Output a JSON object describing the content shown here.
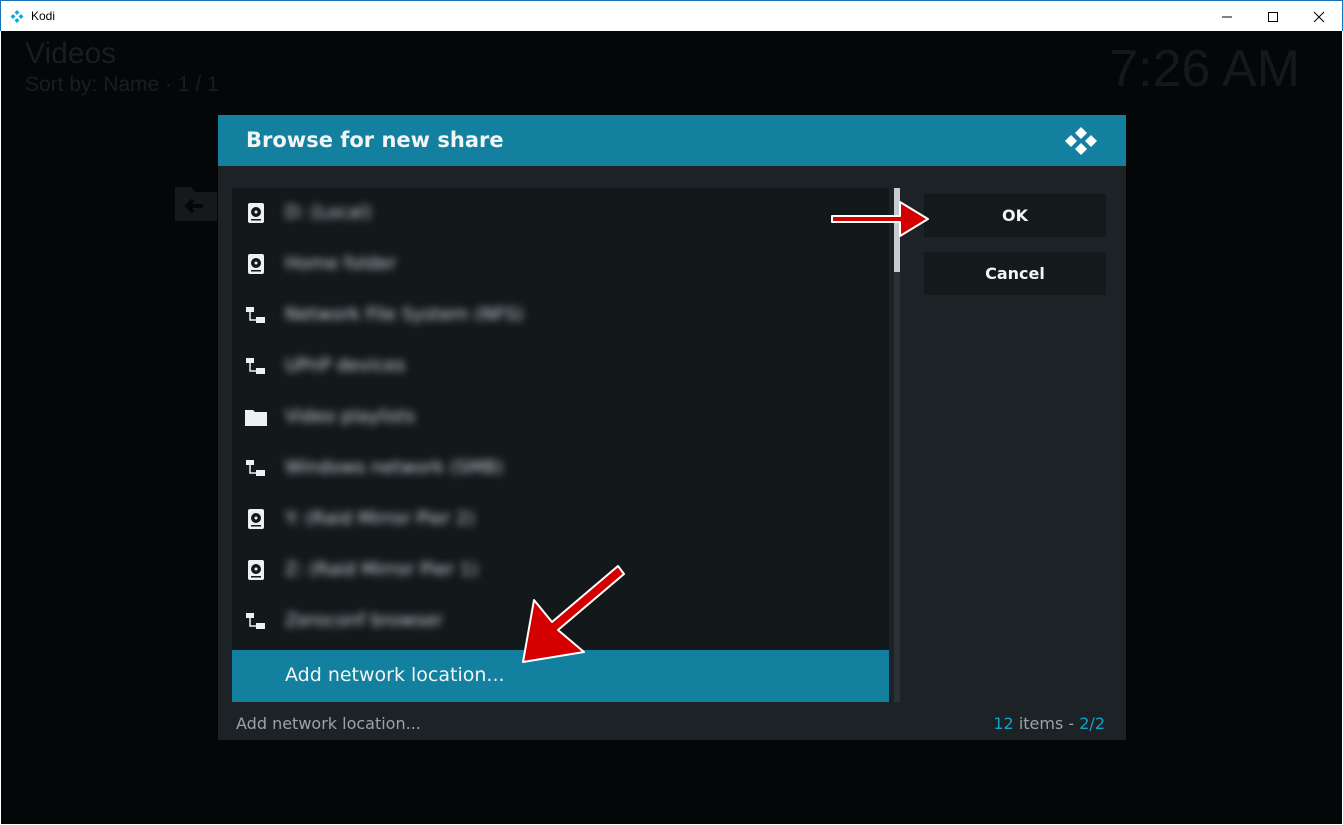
{
  "window": {
    "title": "Kodi"
  },
  "background": {
    "section_title": "Videos",
    "sort_info": "Sort by: Name  ·  1 / 1",
    "clock": "7:26 AM"
  },
  "dialog": {
    "title": "Browse for new share",
    "items": [
      {
        "label": "D: (Local)",
        "icon": "hard-drive-icon"
      },
      {
        "label": "Home folder",
        "icon": "hard-drive-icon"
      },
      {
        "label": "Network File System (NFS)",
        "icon": "network-icon"
      },
      {
        "label": "UPnP devices",
        "icon": "network-icon"
      },
      {
        "label": "Video playlists",
        "icon": "folder-icon"
      },
      {
        "label": "Windows network (SMB)",
        "icon": "network-icon"
      },
      {
        "label": "Y: (Raid Mirror Pier 2)",
        "icon": "hard-drive-icon"
      },
      {
        "label": "Z: (Raid Mirror Pier 1)",
        "icon": "hard-drive-icon"
      },
      {
        "label": "Zeroconf browser",
        "icon": "network-icon"
      },
      {
        "label": "Add network location...",
        "icon": ""
      }
    ],
    "ok_label": "OK",
    "cancel_label": "Cancel",
    "footer_label": "Add network location...",
    "count": "12",
    "count_label": "items",
    "separator": " - ",
    "page": "2/2",
    "colors": {
      "accent": "#12809e",
      "panel": "#1c2226",
      "list": "#13181b",
      "arrow": "#d40000"
    }
  }
}
